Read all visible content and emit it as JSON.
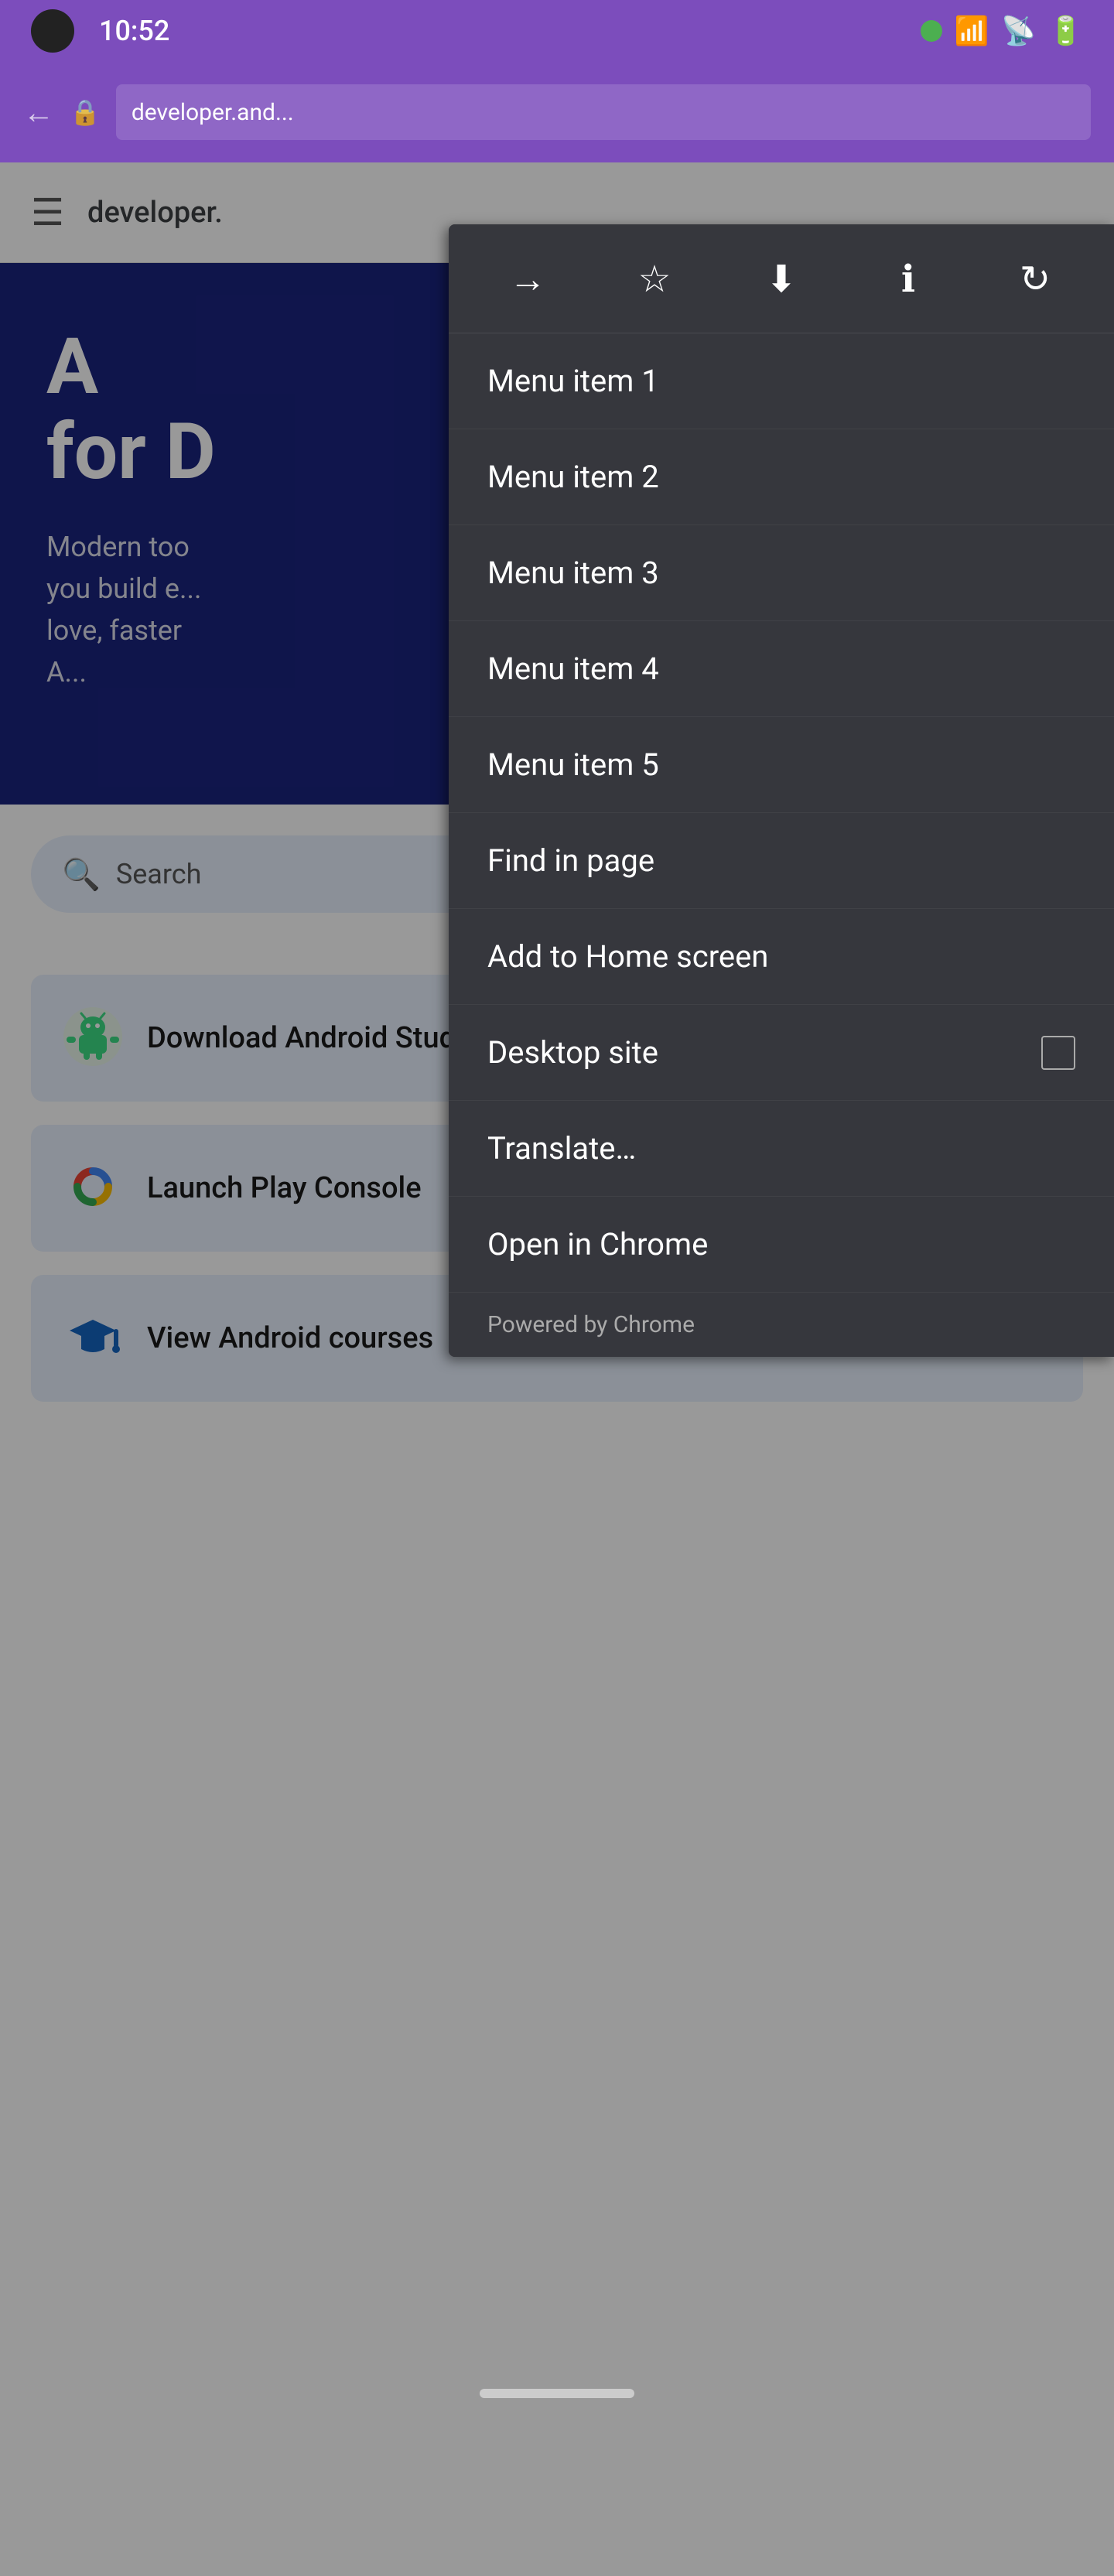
{
  "statusBar": {
    "time": "10:52",
    "icons": [
      "wifi",
      "signal",
      "battery"
    ]
  },
  "browserBar": {
    "addressText": "developer.and...",
    "backLabel": "←",
    "lockLabel": "🔒"
  },
  "devHeader": {
    "title": "developer.",
    "hamburgerLabel": "☰"
  },
  "hero": {
    "headline": "A\nfor D",
    "subtext": "Modern too...\nyou build e...\nlove, faster\nA..."
  },
  "search": {
    "placeholder": "Search"
  },
  "cards": [
    {
      "title": "Download Android Studio",
      "iconType": "android",
      "actionIcon": "download"
    },
    {
      "title": "Launch Play Console",
      "iconType": "play",
      "actionIcon": "external"
    },
    {
      "title": "View Android courses",
      "iconType": "graduation",
      "actionIcon": ""
    }
  ],
  "menu": {
    "toolbar": {
      "icons": [
        {
          "name": "forward-icon",
          "symbol": "→",
          "label": "Forward"
        },
        {
          "name": "bookmark-icon",
          "symbol": "☆",
          "label": "Bookmark"
        },
        {
          "name": "download-icon",
          "symbol": "⬇",
          "label": "Download"
        },
        {
          "name": "info-icon",
          "symbol": "ℹ",
          "label": "Info"
        },
        {
          "name": "refresh-icon",
          "symbol": "↻",
          "label": "Refresh"
        }
      ]
    },
    "items": [
      {
        "id": "menu-item-1",
        "label": "Menu item 1",
        "hasCheckbox": false
      },
      {
        "id": "menu-item-2",
        "label": "Menu item 2",
        "hasCheckbox": false
      },
      {
        "id": "menu-item-3",
        "label": "Menu item 3",
        "hasCheckbox": false
      },
      {
        "id": "menu-item-4",
        "label": "Menu item 4",
        "hasCheckbox": false
      },
      {
        "id": "menu-item-5",
        "label": "Menu item 5",
        "hasCheckbox": false
      },
      {
        "id": "find-in-page",
        "label": "Find in page",
        "hasCheckbox": false
      },
      {
        "id": "add-to-home-screen",
        "label": "Add to Home screen",
        "hasCheckbox": false
      },
      {
        "id": "desktop-site",
        "label": "Desktop site",
        "hasCheckbox": true
      },
      {
        "id": "translate",
        "label": "Translate…",
        "hasCheckbox": false
      },
      {
        "id": "open-in-chrome",
        "label": "Open in Chrome",
        "hasCheckbox": false
      }
    ],
    "footer": "Powered by Chrome"
  }
}
